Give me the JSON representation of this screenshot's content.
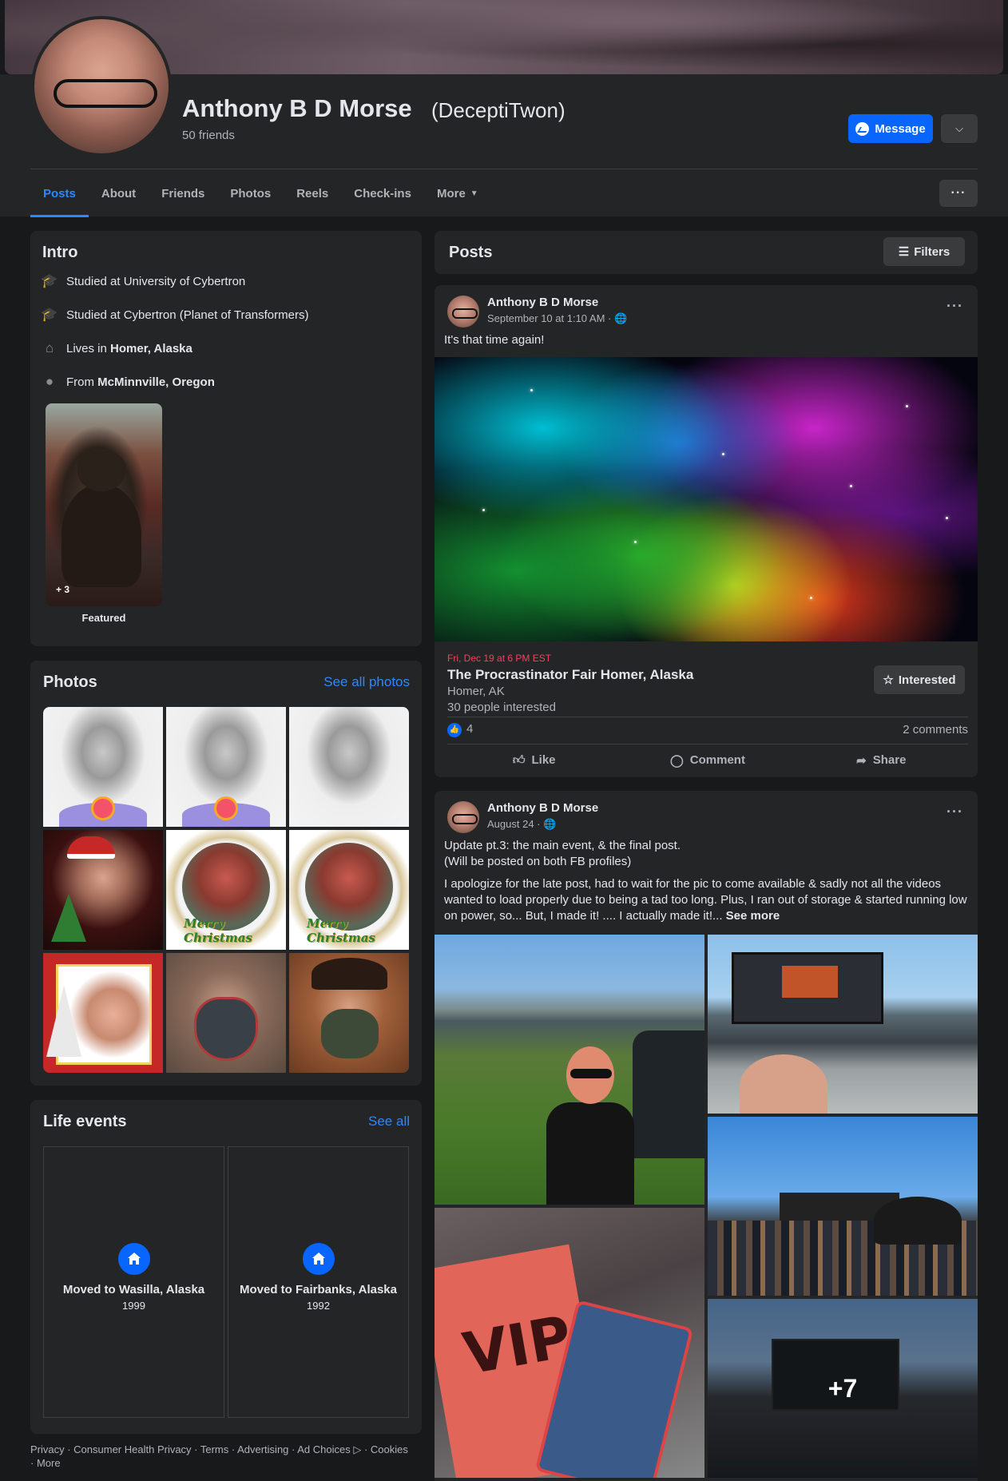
{
  "profile": {
    "name": "Anthony B D Morse",
    "alternate_name": "(DeceptiTwon)",
    "friends": "50 friends",
    "message_label": "Message"
  },
  "tabs": [
    {
      "label": "Posts"
    },
    {
      "label": "About"
    },
    {
      "label": "Friends"
    },
    {
      "label": "Photos"
    },
    {
      "label": "Reels"
    },
    {
      "label": "Check-ins"
    },
    {
      "label": "More"
    }
  ],
  "intro": {
    "title": "Intro",
    "items": [
      {
        "prefix": "Studied at ",
        "value": "University of Cybertron",
        "icon": "graduation-cap-icon"
      },
      {
        "prefix": "Studied at ",
        "value": "Cybertron (Planet of Transformers)",
        "icon": "graduation-cap-icon"
      },
      {
        "prefix": "Lives in ",
        "value": "Homer, Alaska",
        "icon": "home-icon"
      },
      {
        "prefix": "From ",
        "value": "McMinnville, Oregon",
        "icon": "location-pin-icon"
      }
    ],
    "featured_count": "+ 3",
    "featured_label": "Featured"
  },
  "photos": {
    "title": "Photos",
    "see_all": "See all photos",
    "wreath_text": "Merry Christmas"
  },
  "life_events": {
    "title": "Life events",
    "see_all": "See all",
    "items": [
      {
        "title": "Moved to Wasilla, Alaska",
        "year": "1999"
      },
      {
        "title": "Moved to Fairbanks, Alaska",
        "year": "1992"
      }
    ]
  },
  "footer": {
    "links": "Privacy · Consumer Health Privacy · Terms · Advertising · Ad Choices ▷ · Cookies · More"
  },
  "posts": {
    "title": "Posts",
    "filters_label": "Filters",
    "items": [
      {
        "author": "Anthony B D Morse",
        "time": "September 10 at 1:10 AM · ",
        "text": "It's that time again!",
        "event": {
          "date": "Fri, Dec 19 at 6 PM EST",
          "title": "The Procrastinator Fair Homer, Alaska",
          "location": "Homer, AK",
          "interested_count": "30 people interested",
          "interested_label": "Interested"
        },
        "reactions": "4",
        "comments": "2 comments"
      },
      {
        "author": "Anthony B D Morse",
        "time": "August 24 · ",
        "text_line1": "Update pt.3: the main event, & the final post.",
        "text_line2": "(Will be posted on both FB profiles)",
        "text_body": "I apologize for the late post, had to wait for the pic to come available & sadly not all the videos wanted to load properly due to being a tad too long. Plus, I ran out of storage & started running low on power, so... But, I made it! .... I actually made it!...",
        "see_more": "See more",
        "extra_photos": "+7",
        "vip_text": "VIP"
      }
    ]
  },
  "actions": {
    "like": "Like",
    "comment": "Comment",
    "share": "Share"
  },
  "colors": {
    "accent": "#2d88ff",
    "button_blue": "#0866ff",
    "card_bg": "#242526",
    "page_bg": "#18191a",
    "event_date": "#f3425f"
  }
}
